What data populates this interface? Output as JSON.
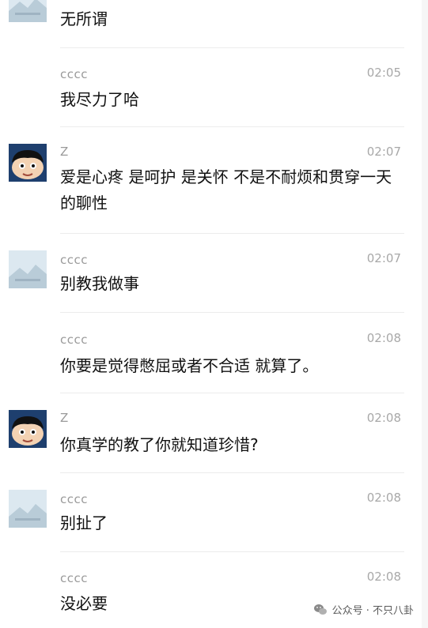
{
  "messages": [
    {
      "sender": "",
      "time": "",
      "text": "无所谓",
      "avatar": "landscape"
    },
    {
      "sender": "cccc",
      "time": "02:05",
      "text": "我尽力了哈",
      "avatar": "none"
    },
    {
      "sender": "Z",
      "time": "02:07",
      "text": "爱是心疼 是呵护 是关怀 不是不耐烦和贯穿一天的聊性",
      "avatar": "cartoon"
    },
    {
      "sender": "cccc",
      "time": "02:07",
      "text": "别教我做事",
      "avatar": "landscape"
    },
    {
      "sender": "cccc",
      "time": "02:08",
      "text": "你要是觉得憋屈或者不合适 就算了。",
      "avatar": "none"
    },
    {
      "sender": "Z",
      "time": "02:08",
      "text": "你真学的教了你就知道珍惜?",
      "avatar": "cartoon"
    },
    {
      "sender": "cccc",
      "time": "02:08",
      "text": "别扯了",
      "avatar": "landscape"
    },
    {
      "sender": "cccc",
      "time": "02:08",
      "text": "没必要",
      "avatar": "none"
    }
  ],
  "watermark": {
    "text": "公众号 · 不只八卦",
    "icon": "wechat-icon"
  },
  "colors": {
    "text": "#111111",
    "meta": "#a8a8a8",
    "divider": "#ececec"
  }
}
